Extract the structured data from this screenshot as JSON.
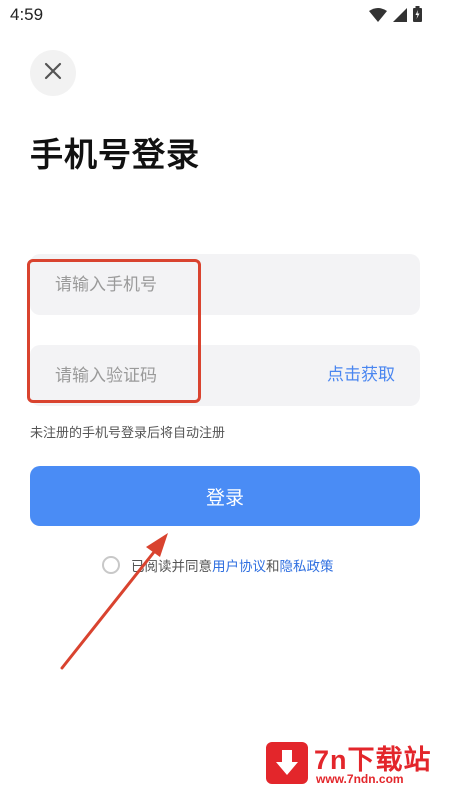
{
  "status_bar": {
    "time": "4:59",
    "icons": [
      "wifi-icon",
      "signal-icon",
      "battery-icon"
    ]
  },
  "header": {
    "close_icon": "close-icon"
  },
  "page": {
    "title": "手机号登录"
  },
  "form": {
    "phone_placeholder": "请输入手机号",
    "phone_value": "",
    "code_placeholder": "请输入验证码",
    "code_value": "",
    "get_code_label": "点击获取",
    "hint": "未注册的手机号登录后将自动注册",
    "login_label": "登录"
  },
  "agreement": {
    "checked": false,
    "prefix": "已阅读并同意",
    "user_agreement": "用户协议",
    "conjunction": "和",
    "privacy_policy": "隐私政策"
  },
  "watermark": {
    "title": "7n下载站",
    "url": "www.7ndn.com"
  },
  "colors": {
    "accent": "#4a8cf5",
    "link": "#2f6fe0",
    "annotation": "#d9432f",
    "input_bg": "#f3f3f5"
  }
}
